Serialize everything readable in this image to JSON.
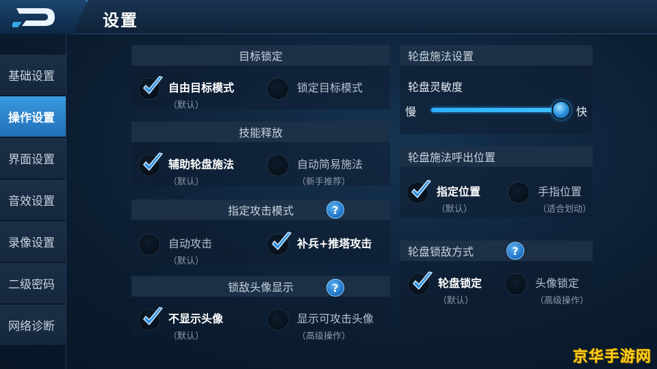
{
  "header": {
    "title": "设置"
  },
  "sidebar": {
    "items": [
      {
        "label": "基础设置",
        "active": false
      },
      {
        "label": "操作设置",
        "active": true
      },
      {
        "label": "界面设置",
        "active": false
      },
      {
        "label": "音效设置",
        "active": false
      },
      {
        "label": "录像设置",
        "active": false
      },
      {
        "label": "二级密码",
        "active": false
      },
      {
        "label": "网络诊断",
        "active": false
      }
    ]
  },
  "target_lock": {
    "title": "目标锁定",
    "opt1": {
      "label": "自由目标模式",
      "sub": "（默认）",
      "checked": true
    },
    "opt2": {
      "label": "锁定目标模式",
      "checked": false
    }
  },
  "skill_cast": {
    "title": "技能释放",
    "opt1": {
      "label": "辅助轮盘施法",
      "sub": "（默认）",
      "checked": true
    },
    "opt2": {
      "label": "自动简易施法",
      "sub": "（新手推荐）",
      "checked": false
    }
  },
  "attack_mode": {
    "title": "指定攻击模式",
    "help": "?",
    "opt1": {
      "label": "自动攻击",
      "sub": "（默认）",
      "checked": false
    },
    "opt2": {
      "label": "补兵+推塔攻击",
      "checked": true
    }
  },
  "enemy_avatar": {
    "title": "锁敌头像显示",
    "help": "?",
    "opt1": {
      "label": "不显示头像",
      "sub": "（默认）",
      "checked": true
    },
    "opt2": {
      "label": "显示可攻击头像",
      "sub": "（高级操作）",
      "checked": false
    }
  },
  "wheel_settings": {
    "title": "轮盘施法设置",
    "sensitivity_label": "轮盘灵敏度",
    "slow": "慢",
    "fast": "快",
    "sensitivity_value": 1.0
  },
  "wheel_position": {
    "title": "轮盘施法呼出位置",
    "opt1": {
      "label": "指定位置",
      "sub": "（默认）",
      "checked": true
    },
    "opt2": {
      "label": "手指位置",
      "sub": "（适合划动）",
      "checked": false
    }
  },
  "wheel_lock": {
    "title": "轮盘锁敌方式",
    "help": "?",
    "opt1": {
      "label": "轮盘锁定",
      "sub": "（默认）",
      "checked": true
    },
    "opt2": {
      "label": "头像锁定",
      "sub": "（高级操作）",
      "checked": false
    }
  },
  "colors": {
    "accent": "#2cb0ff",
    "active_tab": "#2a86d0",
    "watermark": "#ffd21a"
  },
  "watermark": "京华手游网"
}
